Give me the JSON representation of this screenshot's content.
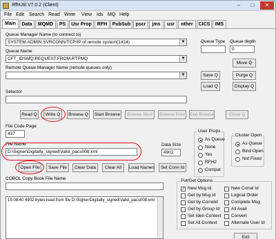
{
  "window": {
    "title": "RfhUtil V7.0.2 (Client)",
    "minimize": "–",
    "maximize": "□",
    "close": "✕"
  },
  "menu": [
    "File",
    "Edit",
    "Search",
    "Read",
    "Write",
    "View",
    "Ids",
    "MQ",
    "Help"
  ],
  "tabs": [
    "Main",
    "Data",
    "MQMD",
    "PS",
    "Usr Prop",
    "RFH",
    "PubSub",
    "pscr",
    "jms",
    "usr",
    "other",
    "CICS",
    "IMS"
  ],
  "main": {
    "qmgr_label": "Queue Manager Name (to connect to)",
    "qmgr_value": "SYSTEM.ADMIN.SVRCONN/TCP/IP of remote system(1414)",
    "queue_label": "Queue Name",
    "queue_value": "CFT_IDSMQ.REQUEST.FROM.RTPMQ",
    "remote_qmgr_label": "Remote Queue Manager Name (remote queues only)",
    "remote_qmgr_value": "",
    "selector_label": "Selector",
    "selector_value": "",
    "queue_type_label": "Queue Type",
    "queue_type_value": "",
    "queue_depth_label": "Queue depth",
    "queue_depth_value": "0",
    "move_q": "Move Q",
    "save_q": "Save Q",
    "purge_q": "Purge Q",
    "load_q": "Load Q",
    "display_q": "Display Q",
    "read_q": "Read Q",
    "write_q": "Write Q",
    "browse_q": "Browse Q",
    "start_browse": "Start Browse",
    "browse_next": "Browse Next",
    "browse_prev": "Browse Prev",
    "end_browse": "End Browse",
    "close_q": "Close Q",
    "code_page_label": "File Code Page",
    "code_page_value": "437",
    "file_name_label": "File Name",
    "file_name_value": "D:\\Signer\\Digitally_signed\\Valid_pacs008.xml",
    "data_size_label": "Data Size",
    "data_size_value": "4902",
    "open_file": "Open File",
    "save_file": "Save File",
    "clear_data": "Clear Data",
    "clear_all": "Clear All",
    "load_names": "Load Names",
    "set_conn_id": "Set Conn Id",
    "cobol_label": "COBOL Copy Book File Name",
    "cobol_value": "",
    "log_line": "19:08:40 4902 bytes read from file D:\\Signer\\Digitally_signed\\Valid_pacs008.xml",
    "exit": "Exit"
  },
  "user_props": {
    "title": "User Props",
    "options": [
      "As Queue",
      "None",
      "Yes",
      "RFH2",
      "Compat"
    ],
    "selected": "As Queue"
  },
  "cluster_open": {
    "title": "Cluster Open",
    "options": [
      "As Queue",
      "Bind Open",
      "Not Fixed"
    ],
    "selected": "As Queue"
  },
  "put_get": {
    "title": "Put/Get Options",
    "left": [
      "New Msg Id",
      "Get by Msg Id",
      "Get by Correlid",
      "Get by Group Id",
      "Set Iden Context",
      "Set All Context"
    ],
    "right": [
      "New Correl Id",
      "Logical Order",
      "Complete Msg",
      "All Avail",
      "Convert",
      "Alternate User Id"
    ],
    "checked": [
      "New Msg Id"
    ]
  },
  "colors": {
    "title_bg": "#d7e4f2",
    "annotation_red": "#e01010"
  }
}
